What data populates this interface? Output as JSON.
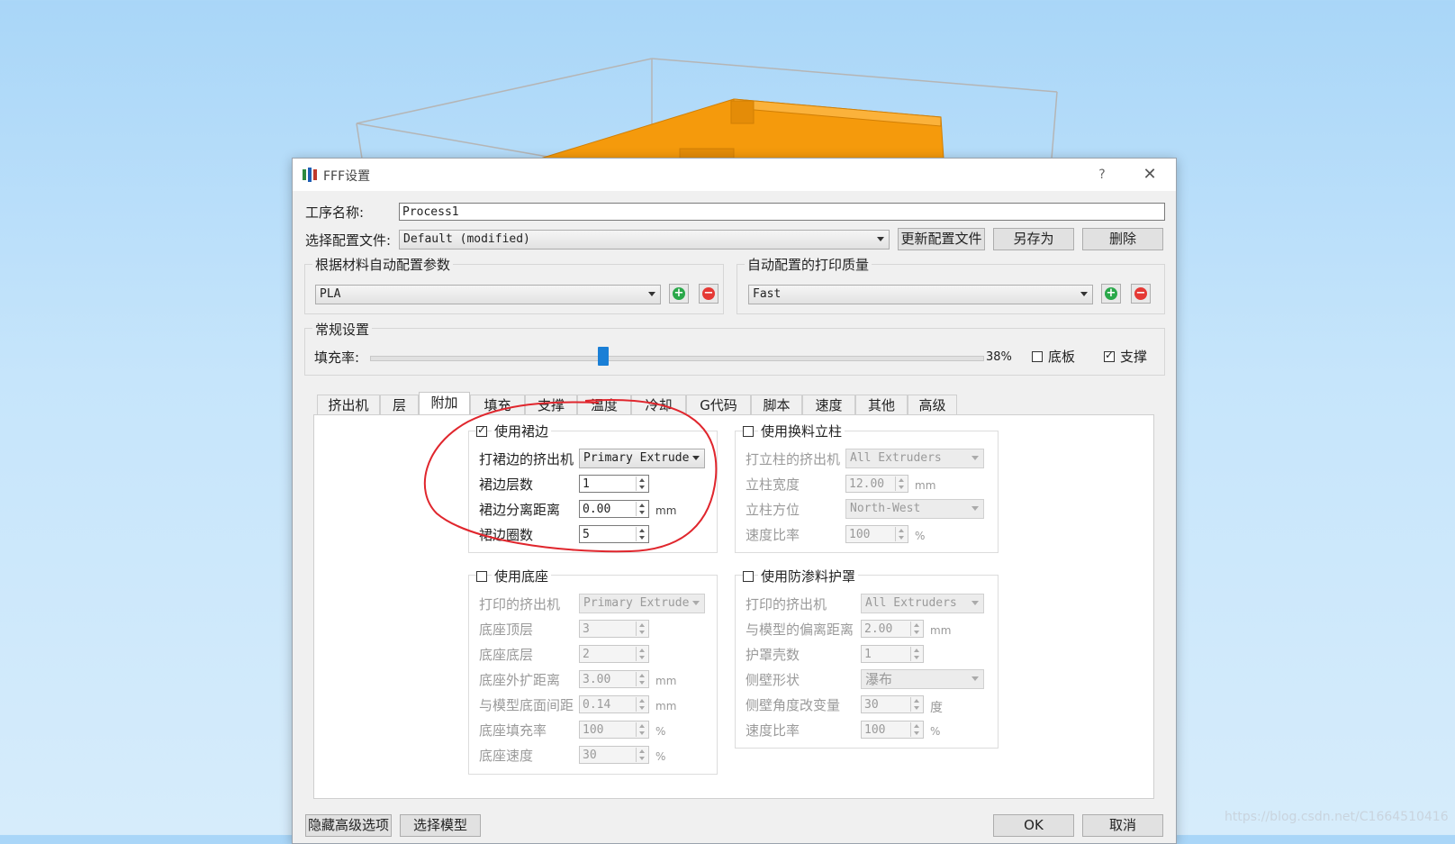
{
  "window": {
    "title": "FFF设置",
    "help": "?",
    "close": "✕"
  },
  "process": {
    "label": "工序名称:",
    "value": "Process1"
  },
  "profile": {
    "label": "选择配置文件:",
    "value": "Default (modified)",
    "update_btn": "更新配置文件",
    "saveas_btn": "另存为",
    "delete_btn": "删除"
  },
  "material": {
    "title": "根据材料自动配置参数",
    "value": "PLA"
  },
  "quality": {
    "title": "自动配置的打印质量",
    "value": "Fast"
  },
  "general": {
    "title": "常规设置",
    "infill_label": "填充率:",
    "infill_value": "38%",
    "infill_fraction": 0.38,
    "raft_label": "底板",
    "raft_checked": false,
    "support_label": "支撑",
    "support_checked": true
  },
  "tabs": [
    "挤出机",
    "层",
    "附加",
    "填充",
    "支撑",
    "温度",
    "冷却",
    "G代码",
    "脚本",
    "速度",
    "其他",
    "高级"
  ],
  "active_tab": "附加",
  "skirt": {
    "title": "使用裙边",
    "checked": true,
    "extruder_label": "打裙边的挤出机",
    "extruder_value": "Primary Extrude",
    "layers_label": "裙边层数",
    "layers_value": "1",
    "offset_label": "裙边分离距离",
    "offset_value": "0.00",
    "offset_unit": "mm",
    "outlines_label": "裙边圈数",
    "outlines_value": "5"
  },
  "prime_pillar": {
    "title": "使用换料立柱",
    "checked": false,
    "extruder_label": "打立柱的挤出机",
    "extruder_value": "All Extruders",
    "width_label": "立柱宽度",
    "width_value": "12.00",
    "width_unit": "mm",
    "location_label": "立柱方位",
    "location_value": "North-West",
    "speed_label": "速度比率",
    "speed_value": "100",
    "speed_unit": "%"
  },
  "raft": {
    "title": "使用底座",
    "checked": false,
    "extruder_label": "打印的挤出机",
    "extruder_value": "Primary Extrude",
    "top_label": "底座顶层",
    "top_value": "3",
    "base_label": "底座底层",
    "base_value": "2",
    "offset_label": "底座外扩距离",
    "offset_value": "3.00",
    "offset_unit": "mm",
    "sep_label": "与模型底面间距",
    "sep_value": "0.14",
    "sep_unit": "mm",
    "infill_label": "底座填充率",
    "infill_value": "100",
    "infill_unit": "%",
    "speed_label": "底座速度",
    "speed_value": "30",
    "speed_unit": "%"
  },
  "ooze_shield": {
    "title": "使用防渗料护罩",
    "checked": false,
    "extruder_label": "打印的挤出机",
    "extruder_value": "All Extruders",
    "offset_label": "与模型的偏离距离",
    "offset_value": "2.00",
    "offset_unit": "mm",
    "outlines_label": "护罩壳数",
    "outlines_value": "1",
    "shape_label": "侧壁形状",
    "shape_value": "瀑布",
    "angle_label": "侧壁角度改变量",
    "angle_value": "30",
    "angle_unit": "度",
    "speed_label": "速度比率",
    "speed_value": "100",
    "speed_unit": "%"
  },
  "footer": {
    "hide_advanced": "隐藏高级选项",
    "select_models": "选择模型",
    "ok": "OK",
    "cancel": "取消"
  },
  "watermark": "https://blog.csdn.net/C1664510416",
  "colors": {
    "model": "#f59a0c",
    "slider": "#1a7fd6",
    "annotation": "#e0262d"
  }
}
